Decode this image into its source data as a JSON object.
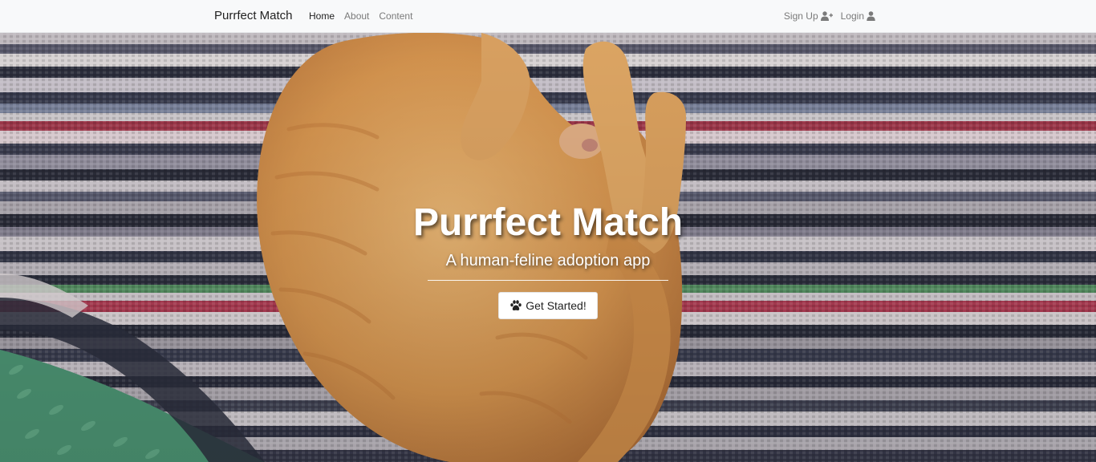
{
  "navbar": {
    "brand": "Purrfect Match",
    "links": [
      {
        "label": "Home",
        "active": true
      },
      {
        "label": "About",
        "active": false
      },
      {
        "label": "Content",
        "active": false
      }
    ],
    "right_links": [
      {
        "label": "Sign Up",
        "icon": "user-plus-icon"
      },
      {
        "label": "Login",
        "icon": "user-icon"
      }
    ]
  },
  "hero": {
    "title": "Purrfect Match",
    "subtitle": "A human-feline adoption app",
    "cta": {
      "label": "Get Started!",
      "icon": "paw-icon"
    }
  },
  "colors": {
    "navbar_bg": "#f8f9fa",
    "active_link": "#222222",
    "inactive_link": "#7a7a7a",
    "cat_orange": "#e0a35c",
    "button_bg": "#ffffff"
  }
}
